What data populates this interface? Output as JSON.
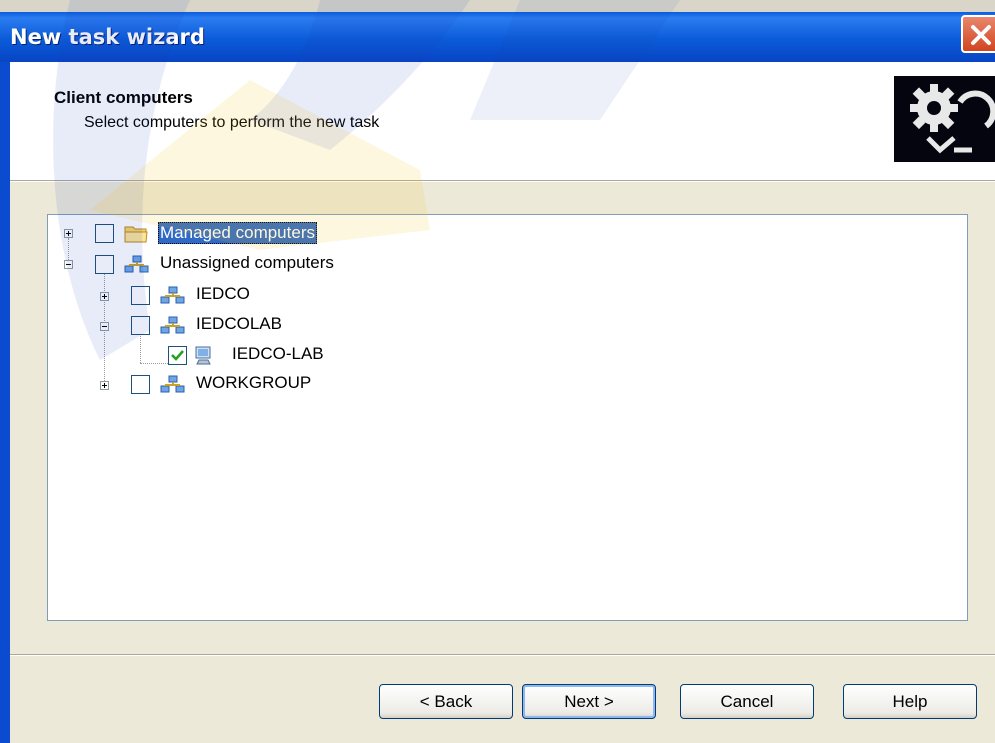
{
  "window": {
    "title": "New task wizard"
  },
  "header": {
    "title": "Client computers",
    "subtitle": "Select computers to perform the new task"
  },
  "tree": {
    "items": [
      {
        "label": "Managed computers",
        "checked": false,
        "expanded": false,
        "selected": true,
        "icon": "folder-icon"
      },
      {
        "label": "Unassigned computers",
        "checked": false,
        "expanded": true,
        "icon": "network-group-icon"
      },
      {
        "label": "IEDCO",
        "checked": false,
        "expanded": false,
        "icon": "network-group-icon"
      },
      {
        "label": "IEDCOLAB",
        "checked": false,
        "expanded": true,
        "icon": "network-group-icon"
      },
      {
        "label": "IEDCO-LAB",
        "checked": true,
        "icon": "computer-icon"
      },
      {
        "label": "WORKGROUP",
        "checked": false,
        "expanded": false,
        "icon": "network-group-icon"
      }
    ]
  },
  "buttons": {
    "back": "< Back",
    "next": "Next >",
    "cancel": "Cancel",
    "help": "Help"
  },
  "colors": {
    "titlebar": "#0b5bd8",
    "selection": "#316ac5",
    "dialog_bg": "#ece9d8"
  }
}
